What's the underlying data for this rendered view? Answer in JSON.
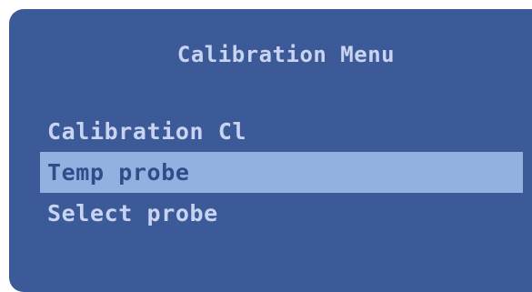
{
  "menu": {
    "title": "Calibration Menu",
    "items": [
      {
        "label": "Calibration Cl",
        "selected": false
      },
      {
        "label": "Temp probe",
        "selected": true
      },
      {
        "label": "Select probe",
        "selected": false
      }
    ]
  },
  "colors": {
    "background": "#3b5a97",
    "text": "#c9d4f2",
    "highlight": "#93b1e0",
    "highlight_text": "#2f4d8a"
  }
}
